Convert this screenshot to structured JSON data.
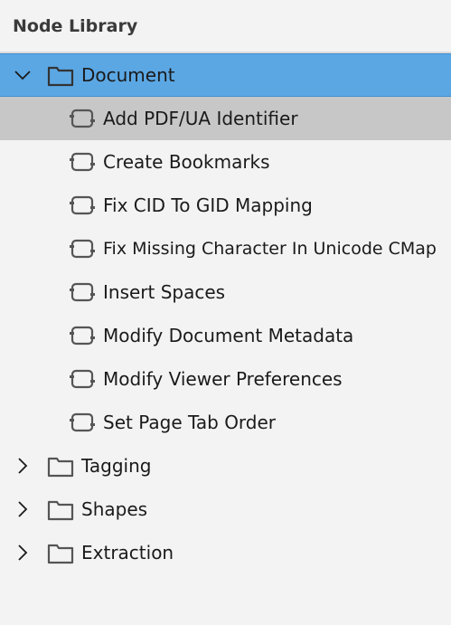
{
  "header": {
    "title": "Node Library"
  },
  "tree": {
    "document": {
      "label": "Document",
      "expanded": true,
      "selected": true,
      "children": [
        "Add PDF/UA Identifier",
        "Create Bookmarks",
        "Fix CID To GID Mapping",
        "Fix Missing Character In Unicode CMap",
        "Insert Spaces",
        "Modify Document Metadata",
        "Modify Viewer Preferences",
        "Set Page Tab Order"
      ]
    },
    "tagging": {
      "label": "Tagging",
      "expanded": false
    },
    "shapes": {
      "label": "Shapes",
      "expanded": false
    },
    "extraction": {
      "label": "Extraction",
      "expanded": false
    }
  },
  "colors": {
    "selected_row": "#5ba7e4",
    "hover_row": "#c7c7c7",
    "background": "#f3f3f3",
    "icon_stroke": "#555555"
  },
  "icons": {
    "folder": "folder-icon",
    "node": "node-icon",
    "expanded": "chevron-down-icon",
    "collapsed": "chevron-right-icon"
  }
}
